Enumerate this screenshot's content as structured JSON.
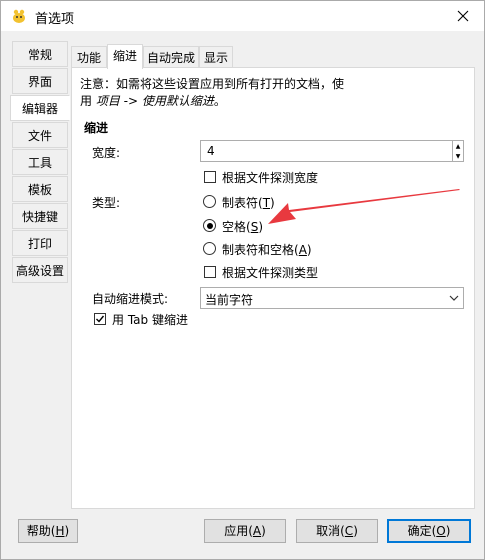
{
  "window": {
    "title": "首选项"
  },
  "sidebar": {
    "items": [
      {
        "label": "常规"
      },
      {
        "label": "界面"
      },
      {
        "label": "编辑器"
      },
      {
        "label": "文件"
      },
      {
        "label": "工具"
      },
      {
        "label": "模板"
      },
      {
        "label": "快捷键"
      },
      {
        "label": "打印"
      },
      {
        "label": "高级设置"
      }
    ],
    "active_index": 2
  },
  "tabs": [
    {
      "label": "功能"
    },
    {
      "label": "缩进"
    },
    {
      "label": "自动完成"
    },
    {
      "label": "显示"
    }
  ],
  "indent": {
    "note_line1": "注意：如需将这些设置应用到所有打开的文档，使",
    "note_line2_prefix": "用 ",
    "note_line2_italic": "项目 -> 使用默认缩进",
    "note_line2_suffix": "。",
    "section_title": "缩进",
    "width_label": "宽度:",
    "width_value": "4",
    "detect_width_label": "根据文件探测宽度",
    "type_label": "类型:",
    "radio_tabs": {
      "text": "制表符(",
      "mnemonic": "T",
      "close": ")"
    },
    "radio_spaces": {
      "text": "空格(",
      "mnemonic": "S",
      "close": ")"
    },
    "radio_both": {
      "text": "制表符和空格(",
      "mnemonic": "A",
      "close": ")"
    },
    "detect_type_label": "根据文件探测类型",
    "auto_indent_label": "自动缩进模式:",
    "auto_indent_value": "当前字符",
    "tab_key_label": "用 Tab 键缩进"
  },
  "buttons": {
    "help": {
      "text": "帮助(",
      "mnemonic": "H",
      "close": ")"
    },
    "apply": {
      "text": "应用(",
      "mnemonic": "A",
      "close": ")"
    },
    "cancel": {
      "text": "取消(",
      "mnemonic": "C",
      "close": ")"
    },
    "ok": {
      "text": "确定(",
      "mnemonic": "O",
      "close": ")"
    }
  },
  "colors": {
    "annotation_arrow": "#e8393f",
    "default_button_border": "#0078d7"
  }
}
